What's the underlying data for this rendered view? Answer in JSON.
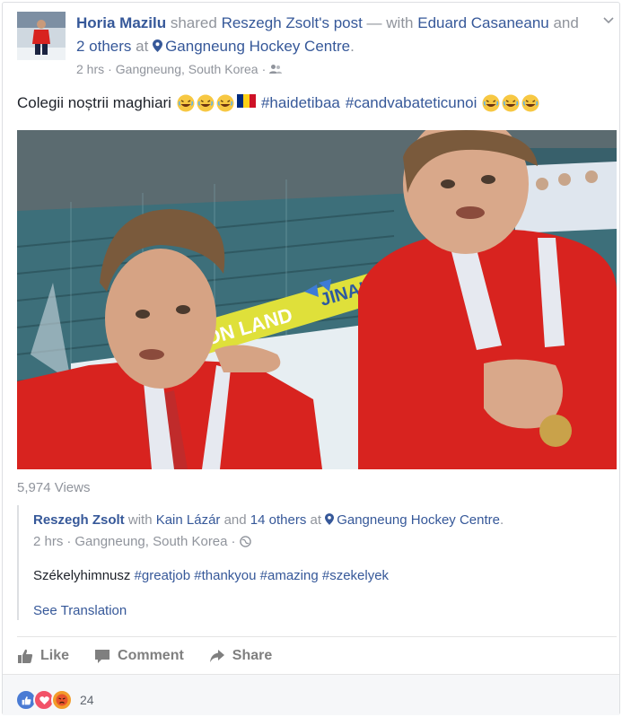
{
  "post": {
    "author": "Horia Mazilu",
    "shared_text": " shared ",
    "shared_from": "Reszegh Zsolt's post",
    "with_text": " — with ",
    "tagged1": "Eduard Casaneanu",
    "and_text": " and ",
    "others": "2 others",
    "at_text": " at ",
    "place": "Gangneung Hockey Centre",
    "period": ".",
    "time": "2 hrs",
    "location": "Gangneung, South Korea",
    "sep": "·",
    "caption": "Colegii noștrii maghiari",
    "hashtag1": "#haidetibaa",
    "hashtag2": "#candvabateticunoi"
  },
  "photo": {
    "banner1": "ON LAND",
    "banner2": "JINAIR"
  },
  "views": "5,974 Views",
  "shared_post": {
    "author": "Reszegh Zsolt",
    "with_text": " with ",
    "tagged": "Kain Lázár",
    "and_text": " and ",
    "others": "14 others",
    "at_text": " at ",
    "place": "Gangneung Hockey Centre",
    "period": ".",
    "time": "2 hrs",
    "location": "Gangneung, South Korea",
    "sep": "·",
    "text_start": "Székelyhimnusz ",
    "tags": "#greatjob #thankyou #amazing #szekelyek",
    "see_translation": "See Translation"
  },
  "actions": {
    "like": "Like",
    "comment": "Comment",
    "share": "Share"
  },
  "reactions": {
    "count": "24"
  },
  "colors": {
    "link": "#365899",
    "muted": "#90949c",
    "jersey": "#d8231f"
  }
}
